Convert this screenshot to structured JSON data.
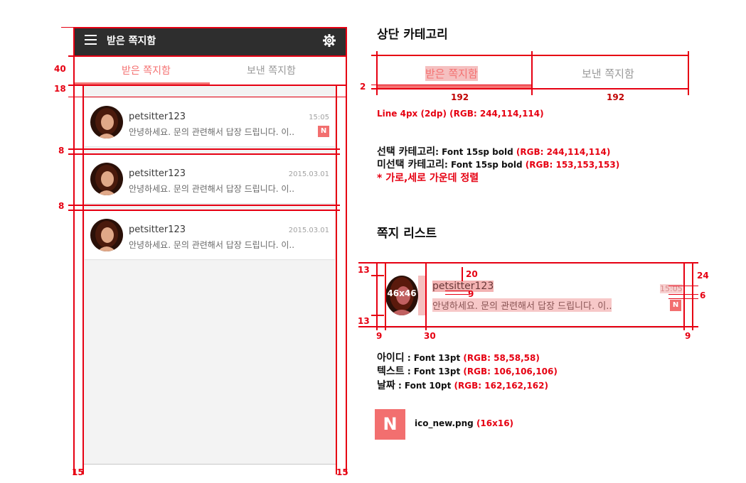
{
  "app_bar": {
    "title": "받은 쪽지함",
    "menu_icon": "menu-icon",
    "settings_icon": "gear-icon"
  },
  "tabs": [
    {
      "label": "받은 쪽지함",
      "active": true
    },
    {
      "label": "보낸 쪽지함",
      "active": false
    }
  ],
  "messages": [
    {
      "user_id": "petsitter123",
      "preview": "안녕하세요. 문의 관련해서 답장 드립니다. 이..",
      "date": "15:05",
      "new": true,
      "badge": "N"
    },
    {
      "user_id": "petsitter123",
      "preview": "안녕하세요. 문의 관련해서 답장 드립니다. 이..",
      "date": "2015.03.01",
      "new": false
    },
    {
      "user_id": "petsitter123",
      "preview": "안녕하세요. 문의 관련해서 답장 드립니다. 이..",
      "date": "2015.03.01",
      "new": false
    }
  ],
  "measurements": {
    "m40": "40",
    "m18": "18",
    "m8a": "8",
    "m8b": "8",
    "m15l": "15",
    "m15r": "15",
    "m2": "2",
    "m192a": "192",
    "m192b": "192",
    "m13a": "13",
    "m13b": "13",
    "m20": "20",
    "m9a": "9",
    "m24": "24",
    "m6": "6",
    "m9b": "9",
    "m30": "30",
    "m9c": "9"
  },
  "spec": {
    "category_title": "상단 카테고리",
    "tab_active": "받은 쪽지함",
    "tab_inactive": "보낸 쪽지함",
    "line": "Line 4px (2dp) (RGB: 244,114,114)",
    "selected_label": "선택 카테고리",
    "selected_font": ": Font 15sp bold ",
    "selected_rgb": "(RGB: 244,114,114)",
    "unselected_label": "미선택 카테고리",
    "unselected_font": ": Font 15sp bold ",
    "unselected_rgb": "(RGB: 153,153,153)",
    "align_note": "* 가로,세로 가운데 정렬",
    "list_title": "쪽지 리스트",
    "avatar_size": "46x46",
    "sample_id": "petsitter123",
    "sample_text": "안녕하세요. 문의 관련해서 답장 드립니다. 이..",
    "sample_time": "15:05",
    "sample_badge": "N",
    "id_label": "아이디",
    "id_font": " : Font 13pt ",
    "id_rgb": "(RGB: 58,58,58)",
    "text_label": "텍스트",
    "text_font": " : Font 13pt ",
    "text_rgb": "(RGB: 106,106,106)",
    "date_label": "날짜",
    "date_font": " : Font 10pt ",
    "date_rgb": "(RGB: 162,162,162)",
    "icon_letter": "N",
    "icon_file": "ico_new.png ",
    "icon_size": "(16x16)"
  },
  "colors": {
    "accent": "#f47272",
    "appbar": "#2e2e2e",
    "inactive": "#999999",
    "id": "#3a3a3a",
    "text": "#6a6a6a",
    "date": "#a2a2a2",
    "guide": "#e60012"
  }
}
